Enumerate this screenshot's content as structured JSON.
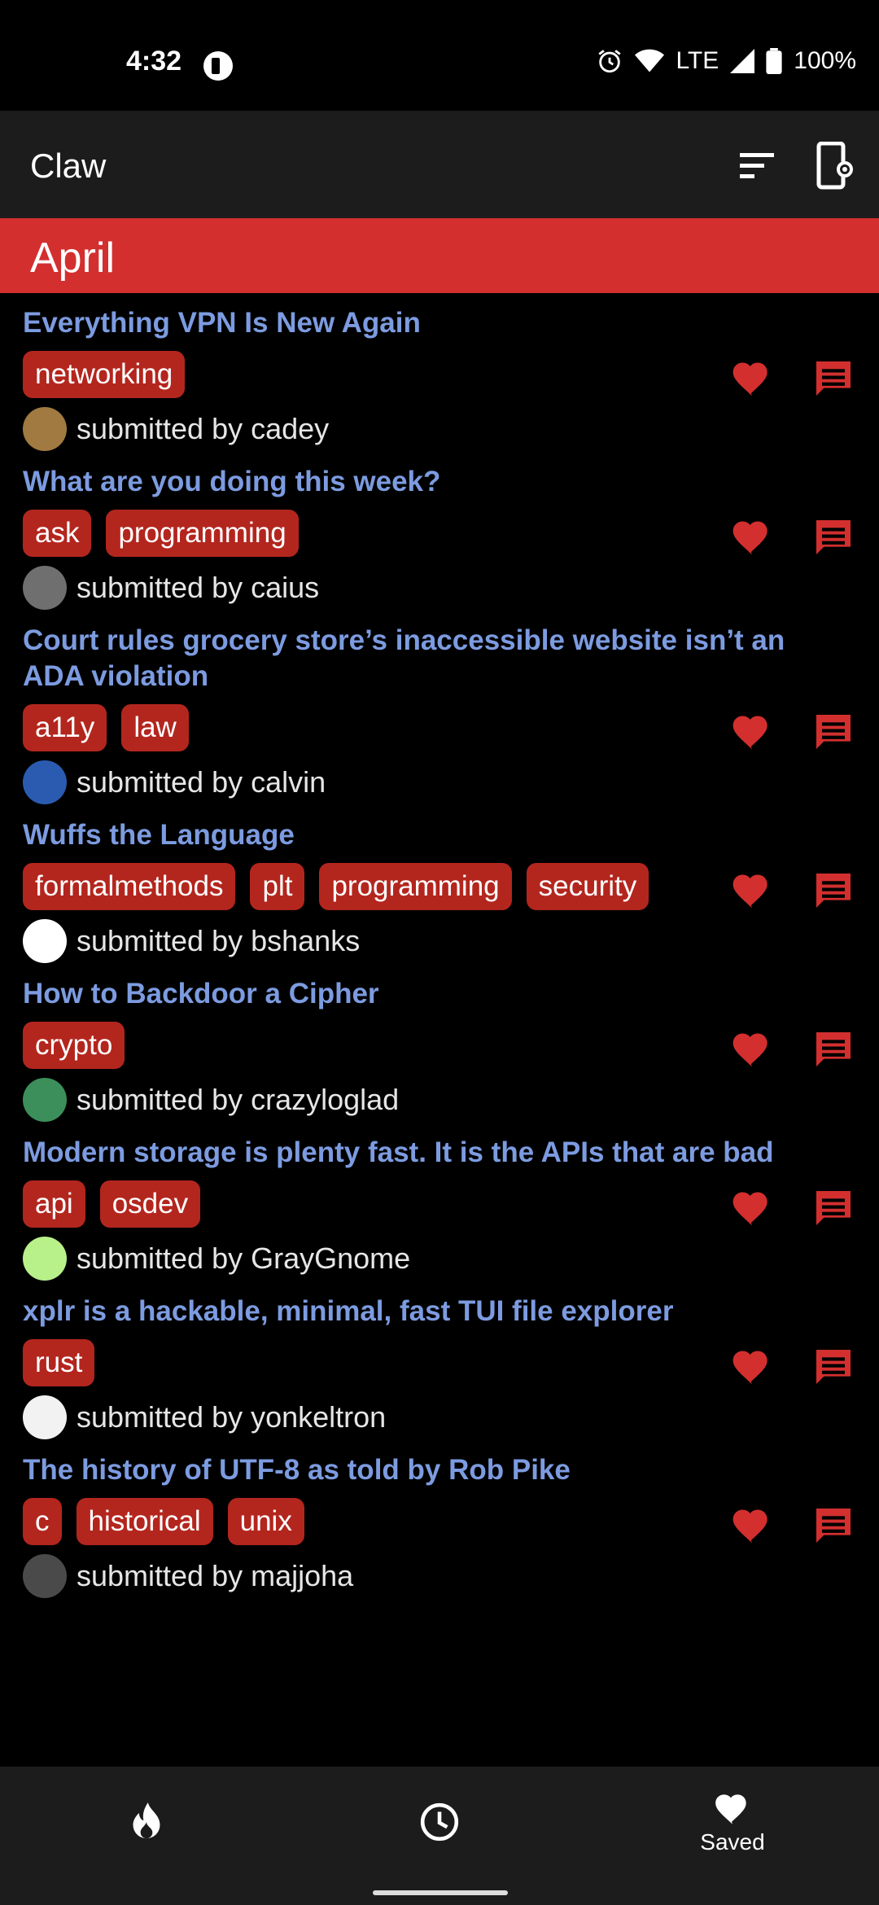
{
  "status": {
    "time": "4:32",
    "network": "LTE",
    "battery": "100%"
  },
  "app": {
    "title": "Claw"
  },
  "month": "April",
  "stories": [
    {
      "title": "Everything VPN Is New Again",
      "tags": [
        "networking"
      ],
      "byline": "submitted by cadey",
      "avatar": "#a07a40"
    },
    {
      "title": "What are you doing this week?",
      "tags": [
        "ask",
        "programming"
      ],
      "byline": "submitted by caius",
      "avatar": "#6f6f6f"
    },
    {
      "title": "Court rules grocery store’s inaccessible website isn’t an ADA violation",
      "tags": [
        "a11y",
        "law"
      ],
      "byline": "submitted by calvin",
      "avatar": "#2a5bb0"
    },
    {
      "title": "Wuffs the Language",
      "tags": [
        "formalmethods",
        "plt",
        "programming",
        "security"
      ],
      "byline": "submitted by bshanks",
      "avatar": "#ffffff"
    },
    {
      "title": "How to Backdoor a Cipher",
      "tags": [
        "crypto"
      ],
      "byline": "submitted by crazyloglad",
      "avatar": "#3c8f5a"
    },
    {
      "title": "Modern storage is plenty fast. It is the APIs that are bad",
      "tags": [
        "api",
        "osdev"
      ],
      "byline": "submitted by GrayGnome",
      "avatar": "#b8f08a"
    },
    {
      "title": "xplr is a hackable, minimal, fast TUI file explorer",
      "tags": [
        "rust"
      ],
      "byline": "submitted by yonkeltron",
      "avatar": "#f2f2f2"
    },
    {
      "title": "The history of UTF-8 as told by Rob Pike",
      "tags": [
        "c",
        "historical",
        "unix"
      ],
      "byline": "submitted by majjoha",
      "avatar": "#4a4a4a"
    }
  ],
  "nav": {
    "saved_label": "Saved"
  },
  "colors": {
    "accent": "#d32f2f",
    "tag": "#b3261e",
    "title": "#7c9be0",
    "bar": "#1c1c1c"
  },
  "icons": {
    "sort": "sort-icon",
    "settings": "settings-phone-icon",
    "like": "heart-icon",
    "comments": "comment-icon",
    "hot": "flame-icon",
    "recent": "clock-icon",
    "saved": "heart-icon"
  }
}
